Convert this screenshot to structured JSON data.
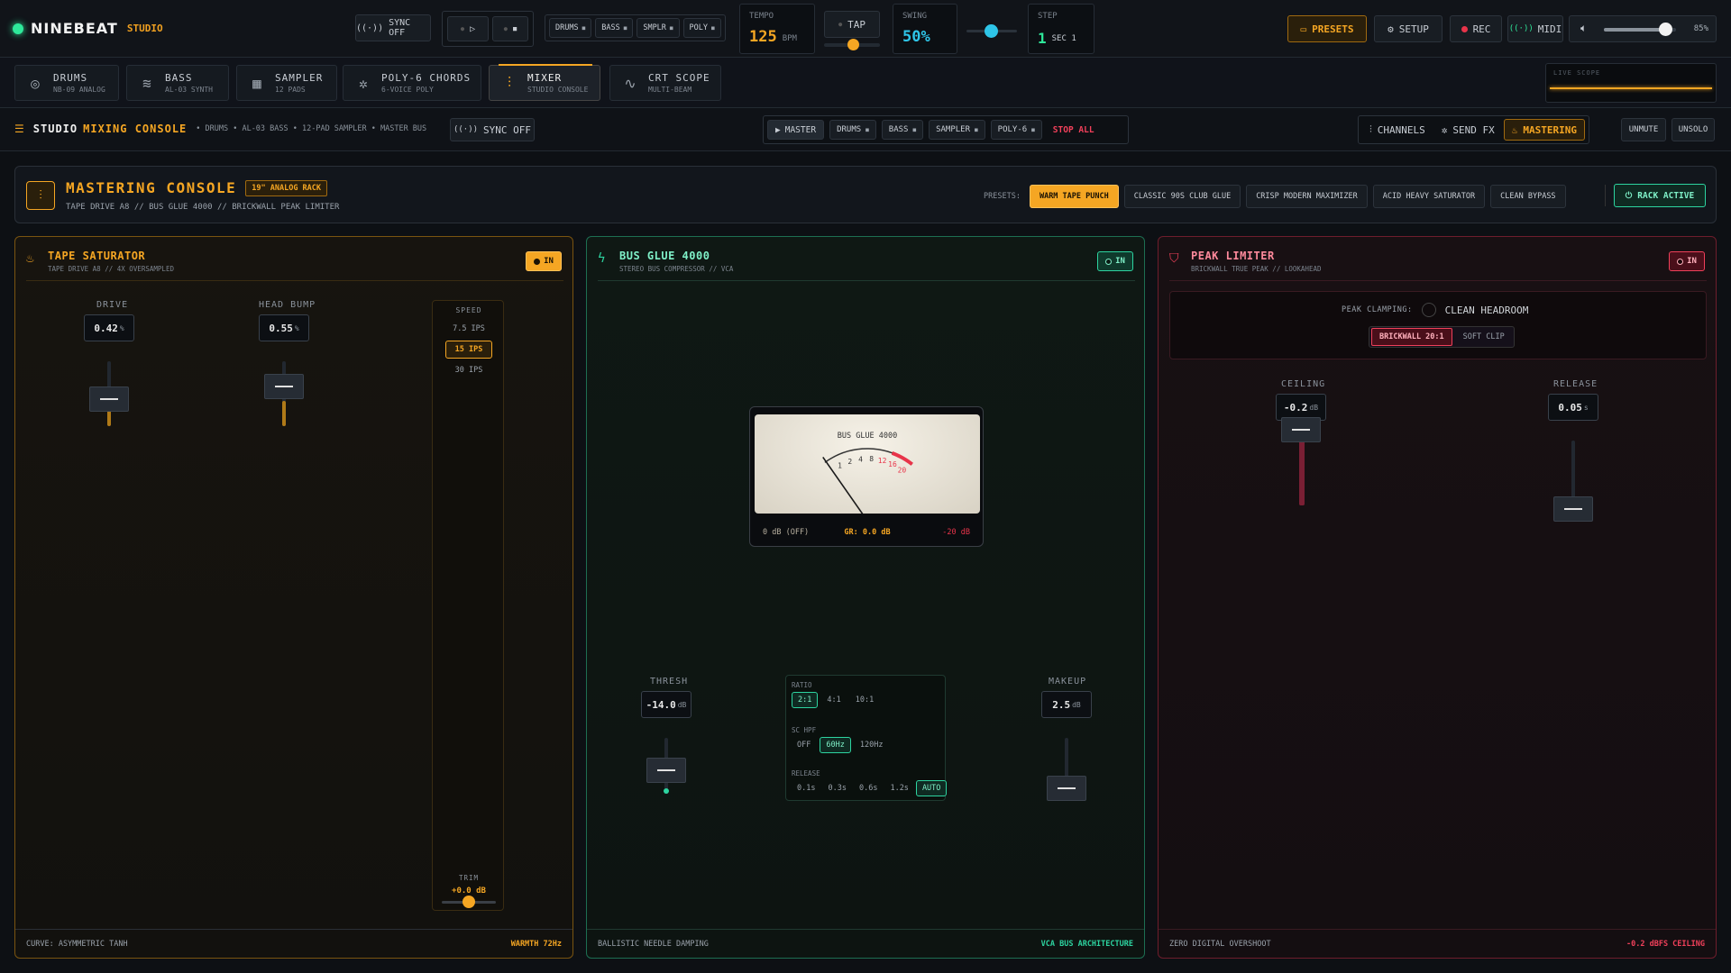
{
  "app": {
    "name": "NINEBEAT",
    "suffix": "STUDIO"
  },
  "topbar": {
    "sync_label": "SYNC OFF",
    "pattern_chips": [
      "DRUMS",
      "BASS",
      "SMPLR",
      "POLY"
    ],
    "tempo": {
      "label": "TEMPO",
      "value": "125",
      "unit": "BPM"
    },
    "tap_label": "TAP",
    "swing": {
      "label": "SWING",
      "value": "50%"
    },
    "step": {
      "label": "STEP",
      "value": "1",
      "sub": "SEC 1"
    },
    "presets_label": "PRESETS",
    "setup_label": "SETUP",
    "rec_label": "REC",
    "midi_label": "MIDI",
    "volume_pct": "85%",
    "volume_level": 0.85
  },
  "tabs": [
    {
      "title": "DRUMS",
      "sub": "NB-09 ANALOG",
      "icon": "disc-icon"
    },
    {
      "title": "BASS",
      "sub": "AL-03 SYNTH",
      "icon": "wave-icon"
    },
    {
      "title": "SAMPLER",
      "sub": "12 PADS",
      "icon": "grid-icon"
    },
    {
      "title": "POLY-6 CHORDS",
      "sub": "6-VOICE POLY",
      "icon": "sparkle-icon"
    },
    {
      "title": "MIXER",
      "sub": "STUDIO CONSOLE",
      "icon": "sliders-icon"
    },
    {
      "title": "CRT SCOPE",
      "sub": "MULTI-BEAM",
      "icon": "pulse-icon"
    }
  ],
  "live_scope_label": "LIVE SCOPE",
  "console": {
    "title_a": "STUDIO",
    "title_b": "MIXING CONSOLE",
    "subtitle": "• DRUMS • AL-03 BASS • 12-PAD SAMPLER • MASTER BUS",
    "sync_label": "SYNC OFF",
    "master_label": "MASTER",
    "chips": [
      "DRUMS",
      "BASS",
      "SAMPLER",
      "POLY-6"
    ],
    "stop_all": "STOP ALL",
    "views": [
      "CHANNELS",
      "SEND FX",
      "MASTERING"
    ],
    "unmute": "UNMUTE",
    "unsolo": "UNSOLO"
  },
  "mastering": {
    "title": "MASTERING CONSOLE",
    "badge": "19\" ANALOG RACK",
    "subtitle": "TAPE DRIVE A8 // BUS GLUE 4000 // BRICKWALL PEAK LIMITER",
    "presets_label": "PRESETS:",
    "presets": [
      "WARM TAPE PUNCH",
      "CLASSIC 90S CLUB GLUE",
      "CRISP MODERN MAXIMIZER",
      "ACID HEAVY SATURATOR",
      "CLEAN BYPASS"
    ],
    "rack_active": "RACK ACTIVE"
  },
  "tape": {
    "title": "TAPE SATURATOR",
    "sub": "TAPE DRIVE A8 // 4X OVERSAMPLED",
    "in": "IN",
    "drive": {
      "label": "DRIVE",
      "value": "0.42",
      "unit": "%"
    },
    "headbump": {
      "label": "HEAD BUMP",
      "value": "0.55",
      "unit": "%"
    },
    "speed": {
      "label": "SPEED",
      "options": [
        "7.5 IPS",
        "15 IPS",
        "30 IPS"
      ]
    },
    "trim": {
      "label": "TRIM",
      "value": "+0.0 dB"
    },
    "foot_left": "CURVE: ASYMMETRIC TANH",
    "foot_right": "WARMTH 72Hz"
  },
  "glue": {
    "title": "BUS GLUE 4000",
    "sub": "STEREO BUS COMPRESSOR // VCA",
    "in": "IN",
    "meter": {
      "name": "BUS GLUE 4000",
      "ticks": [
        "1",
        "2",
        "4",
        "8",
        "12",
        "16",
        "20"
      ],
      "left": "0 dB (OFF)",
      "mid": "GR: 0.0 dB",
      "right": "-20 dB"
    },
    "thresh": {
      "label": "THRESH",
      "value": "-14.0",
      "unit": "dB"
    },
    "makeup": {
      "label": "MAKEUP",
      "value": "2.5",
      "unit": "dB"
    },
    "ratio": {
      "label": "RATIO",
      "options": [
        "2:1",
        "4:1",
        "10:1"
      ]
    },
    "schpf": {
      "label": "SC HPF",
      "options": [
        "OFF",
        "60Hz",
        "120Hz"
      ]
    },
    "release": {
      "label": "RELEASE",
      "options": [
        "0.1s",
        "0.3s",
        "0.6s",
        "1.2s",
        "AUTO"
      ]
    },
    "foot_left": "BALLISTIC NEEDLE DAMPING",
    "foot_right": "VCA BUS ARCHITECTURE"
  },
  "limiter": {
    "title": "PEAK LIMITER",
    "sub": "BRICKWALL TRUE PEAK // LOOKAHEAD",
    "in": "IN",
    "clamp_label": "PEAK CLAMPING:",
    "clamp_value": "CLEAN HEADROOM",
    "modes": [
      "BRICKWALL 20:1",
      "SOFT CLIP"
    ],
    "ceiling": {
      "label": "CEILING",
      "value": "-0.2",
      "unit": "dB"
    },
    "release": {
      "label": "RELEASE",
      "value": "0.05",
      "unit": "s"
    },
    "foot_left": "ZERO DIGITAL OVERSHOOT",
    "foot_right": "-0.2 dBFS CEILING"
  }
}
